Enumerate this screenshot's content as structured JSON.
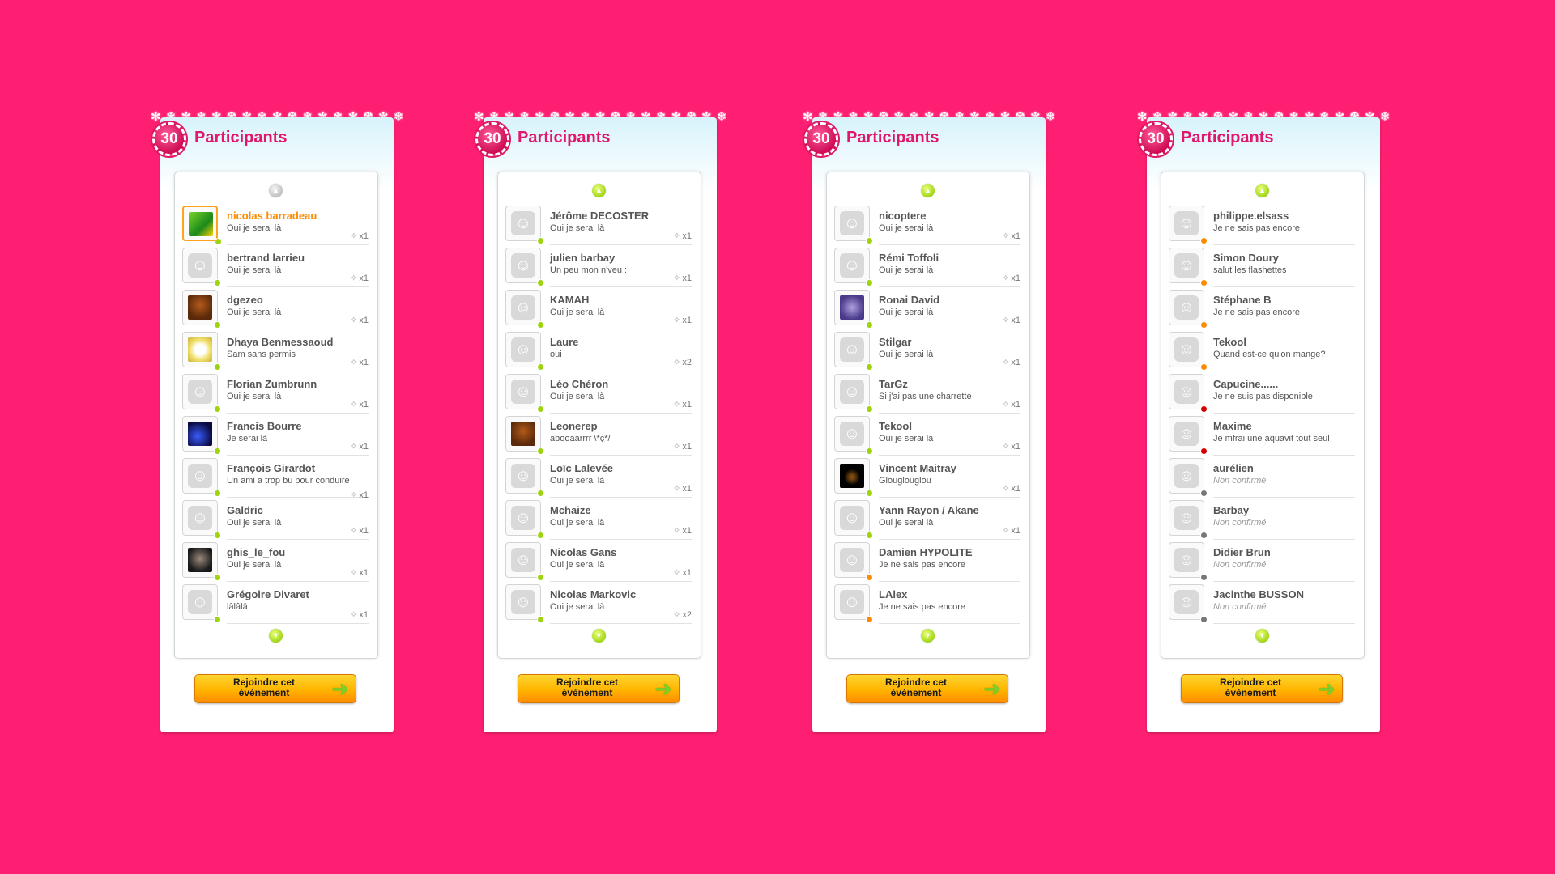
{
  "colors": {
    "background": "#ff1f72",
    "accent": "#e0176b",
    "online": "#9dd30f",
    "maybe": "#ff8a00",
    "busy": "#d60000",
    "pending": "#777777"
  },
  "panels": [
    {
      "count": "30",
      "title": "Participants",
      "join_label": "Rejoindre cet évènement",
      "up_enabled": false,
      "rows": [
        {
          "name": "nicolas barradeau",
          "status": "Oui je serai là",
          "count": "x1",
          "dot": "online",
          "avatar": "photo-green",
          "highlight": true
        },
        {
          "name": "bertrand larrieu",
          "status": "Oui je serai là",
          "count": "x1",
          "dot": "online",
          "avatar": "default"
        },
        {
          "name": "dgezeo",
          "status": "Oui je serai là",
          "count": "x1",
          "dot": "online",
          "avatar": "photo-brown"
        },
        {
          "name": "Dhaya Benmessaoud",
          "status": "Sam sans permis",
          "count": "x1",
          "dot": "online",
          "avatar": "photo-cartoon"
        },
        {
          "name": "Florian Zumbrunn",
          "status": "Oui je serai là",
          "count": "x1",
          "dot": "online",
          "avatar": "default"
        },
        {
          "name": "Francis Bourre",
          "status": "Je serai là",
          "count": "x1",
          "dot": "online",
          "avatar": "photo-blue"
        },
        {
          "name": "François Girardot",
          "status": "Un ami a trop bu pour conduire",
          "count": "x1",
          "dot": "online",
          "avatar": "default"
        },
        {
          "name": "Galdric",
          "status": "Oui je serai là",
          "count": "x1",
          "dot": "online",
          "avatar": "default"
        },
        {
          "name": "ghis_le_fou",
          "status": "Oui je serai là",
          "count": "x1",
          "dot": "online",
          "avatar": "photo-dark"
        },
        {
          "name": "Grégoire Divaret",
          "status": "lâlâlâ",
          "count": "x1",
          "dot": "online",
          "avatar": "default"
        }
      ]
    },
    {
      "count": "30",
      "title": "Participants",
      "join_label": "Rejoindre cet évènement",
      "up_enabled": true,
      "rows": [
        {
          "name": "Jérôme DECOSTER",
          "status": "Oui je serai là",
          "count": "x1",
          "dot": "online",
          "avatar": "default"
        },
        {
          "name": "julien barbay",
          "status": "Un peu mon n'veu :|",
          "count": "x1",
          "dot": "online",
          "avatar": "default"
        },
        {
          "name": "KAMAH",
          "status": "Oui je serai là",
          "count": "x1",
          "dot": "online",
          "avatar": "default"
        },
        {
          "name": "Laure",
          "status": "oui",
          "count": "x2",
          "dot": "online",
          "avatar": "default"
        },
        {
          "name": "Léo Chéron",
          "status": "Oui je serai là",
          "count": "x1",
          "dot": "online",
          "avatar": "default"
        },
        {
          "name": "Leonerep",
          "status": "abooaarrrr \\*ç*/",
          "count": "x1",
          "dot": "online",
          "avatar": "photo-brown"
        },
        {
          "name": "Loïc Lalevée",
          "status": "Oui je serai là",
          "count": "x1",
          "dot": "online",
          "avatar": "default"
        },
        {
          "name": "Mchaize",
          "status": "Oui je serai là",
          "count": "x1",
          "dot": "online",
          "avatar": "default"
        },
        {
          "name": "Nicolas Gans",
          "status": "Oui je serai là",
          "count": "x1",
          "dot": "online",
          "avatar": "default"
        },
        {
          "name": "Nicolas Markovic",
          "status": "Oui je serai là",
          "count": "x2",
          "dot": "online",
          "avatar": "default"
        }
      ]
    },
    {
      "count": "30",
      "title": "Participants",
      "join_label": "Rejoindre cet évènement",
      "up_enabled": true,
      "rows": [
        {
          "name": "nicoptere",
          "status": "Oui je serai là",
          "count": "x1",
          "dot": "online",
          "avatar": "default"
        },
        {
          "name": "Rémi Toffoli",
          "status": "Oui je serai là",
          "count": "x1",
          "dot": "online",
          "avatar": "default"
        },
        {
          "name": "Ronai David",
          "status": "Oui je serai là",
          "count": "x1",
          "dot": "online",
          "avatar": "photo-purple"
        },
        {
          "name": "Stilgar",
          "status": "Oui je serai là",
          "count": "x1",
          "dot": "online",
          "avatar": "default"
        },
        {
          "name": "TarGz",
          "status": "Si j'ai pas une charrette",
          "count": "x1",
          "dot": "online",
          "avatar": "default"
        },
        {
          "name": "Tekool",
          "status": "Oui je serai là",
          "count": "x1",
          "dot": "online",
          "avatar": "default"
        },
        {
          "name": "Vincent Maitray",
          "status": "Glouglouglou",
          "count": "x1",
          "dot": "online",
          "avatar": "photo-black"
        },
        {
          "name": "Yann Rayon / Akane",
          "status": "Oui je serai là",
          "count": "x1",
          "dot": "online",
          "avatar": "default"
        },
        {
          "name": "Damien HYPOLITE",
          "status": "Je ne sais pas encore",
          "count": "",
          "dot": "maybe",
          "avatar": "default"
        },
        {
          "name": "LAlex",
          "status": "Je ne sais pas encore",
          "count": "",
          "dot": "maybe",
          "avatar": "default"
        }
      ]
    },
    {
      "count": "30",
      "title": "Participants",
      "join_label": "Rejoindre cet évènement",
      "up_enabled": true,
      "rows": [
        {
          "name": "philippe.elsass",
          "status": "Je ne sais pas encore",
          "count": "",
          "dot": "maybe",
          "avatar": "default"
        },
        {
          "name": "Simon Doury",
          "status": "salut les flashettes",
          "count": "",
          "dot": "maybe",
          "avatar": "default"
        },
        {
          "name": "Stéphane B",
          "status": "Je ne sais pas encore",
          "count": "",
          "dot": "maybe",
          "avatar": "default"
        },
        {
          "name": "Tekool",
          "status": "Quand est-ce qu'on mange?",
          "count": "",
          "dot": "maybe",
          "avatar": "default"
        },
        {
          "name": "Capucine......",
          "status": "Je ne suis pas disponible",
          "count": "",
          "dot": "busy",
          "avatar": "default"
        },
        {
          "name": "Maxime",
          "status": "Je mfrai une aquavit tout seul",
          "count": "",
          "dot": "busy",
          "avatar": "default"
        },
        {
          "name": "aurélien",
          "status": "Non confirmé",
          "count": "",
          "dot": "pending",
          "avatar": "default"
        },
        {
          "name": "Barbay",
          "status": "Non confirmé",
          "count": "",
          "dot": "pending",
          "avatar": "default"
        },
        {
          "name": "Didier Brun",
          "status": "Non confirmé",
          "count": "",
          "dot": "pending",
          "avatar": "default"
        },
        {
          "name": "Jacinthe BUSSON",
          "status": "Non confirmé",
          "count": "",
          "dot": "pending",
          "avatar": "default"
        }
      ]
    }
  ]
}
